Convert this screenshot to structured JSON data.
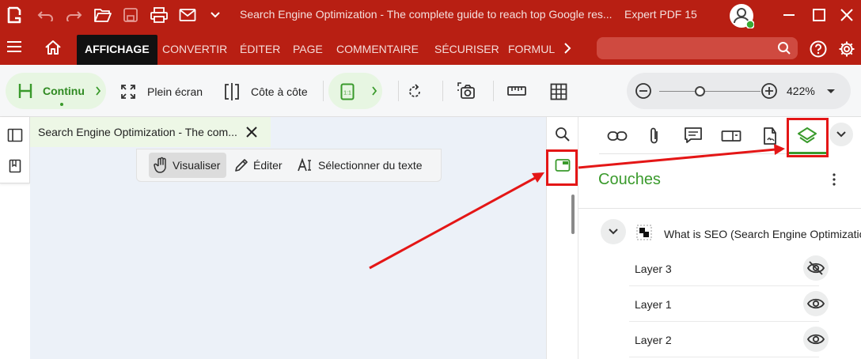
{
  "titlebar": {
    "document_title": "Search Engine Optimization - The complete guide to reach top Google res...",
    "app_name": "Expert PDF 15"
  },
  "menu": {
    "tabs": [
      "AFFICHAGE",
      "CONVERTIR",
      "ÉDITER",
      "PAGE",
      "COMMENTAIRE",
      "SÉCURISER",
      "FORMUL"
    ],
    "active_index": 0
  },
  "toolbar": {
    "continuous_label": "Continu",
    "fullscreen_label": "Plein écran",
    "side_by_side_label": "Côte à côte",
    "zoom_value": "422%",
    "zoom_level": 0.4
  },
  "document": {
    "tab_title": "Search Engine Optimization - The com..."
  },
  "modes": {
    "view_label": "Visualiser",
    "edit_label": "Éditer",
    "select_label": "Sélectionner du texte"
  },
  "panel": {
    "title": "Couches",
    "root_layer": "What is SEO (Search Engine Optimization",
    "layers": [
      {
        "name": "Layer 3",
        "visible": false
      },
      {
        "name": "Layer 1",
        "visible": true
      },
      {
        "name": "Layer 2",
        "visible": true
      }
    ]
  },
  "colors": {
    "brand_red": "#b81f13",
    "accent_green": "#3a9a2c",
    "annotation_red": "#e41616"
  }
}
